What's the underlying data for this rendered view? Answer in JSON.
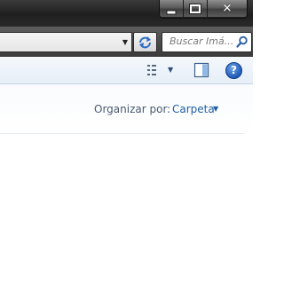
{
  "window": {
    "minimize_glyph": "minimize-icon",
    "maximize_glyph": "maximize-icon",
    "close_glyph": "✕"
  },
  "addressbar": {
    "address_dropdown_icon": "chevron-down-icon",
    "refresh_icon": "refresh-icon",
    "search_placeholder": "Buscar Imá...",
    "search_icon": "search-icon"
  },
  "toolbar": {
    "view_icon": "view-options-icon",
    "view_dropdown_icon": "chevron-down-icon",
    "preview_pane_icon": "preview-pane-icon",
    "help_label": "?"
  },
  "content_header": {
    "arrange_label": "Organizar por:",
    "arrange_value": "Carpeta"
  },
  "colors": {
    "titlebar": "#262626",
    "link_blue": "#1e5fa8",
    "toolbar_bg": "#eaf1f8"
  }
}
